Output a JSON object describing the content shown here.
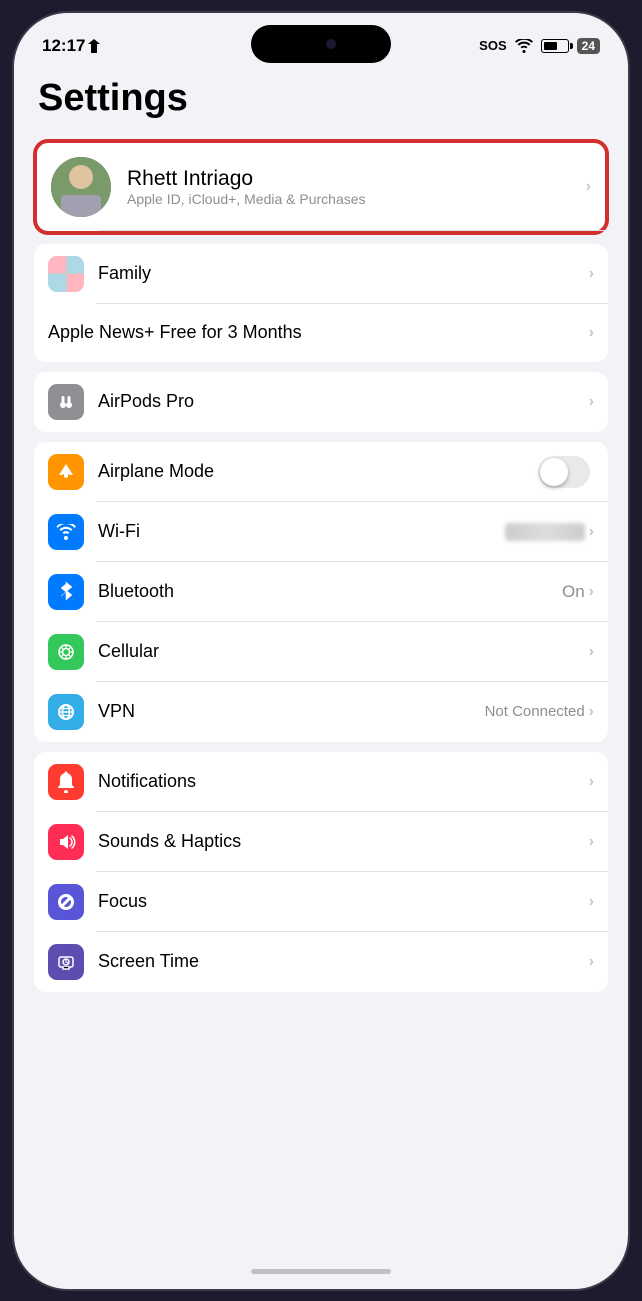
{
  "status_bar": {
    "time": "12:17",
    "sos": "SOS",
    "location_icon": "location-arrow"
  },
  "page": {
    "title": "Settings"
  },
  "profile": {
    "name": "Rhett Intriago",
    "subtitle": "Apple ID, iCloud+, Media & Purchases",
    "chevron": "›"
  },
  "group1": {
    "items": [
      {
        "label": "Family",
        "chevron": "›"
      },
      {
        "label": "Apple News+ Free for 3 Months",
        "chevron": "›"
      }
    ]
  },
  "group2": {
    "items": [
      {
        "label": "AirPods Pro",
        "chevron": "›"
      }
    ]
  },
  "group3": {
    "items": [
      {
        "label": "Airplane Mode",
        "value": ""
      },
      {
        "label": "Wi-Fi",
        "value": "",
        "chevron": "›"
      },
      {
        "label": "Bluetooth",
        "value": "On",
        "chevron": "›"
      },
      {
        "label": "Cellular",
        "chevron": "›"
      },
      {
        "label": "VPN",
        "value": "Not Connected",
        "chevron": "›"
      }
    ]
  },
  "group4": {
    "items": [
      {
        "label": "Notifications",
        "chevron": "›"
      },
      {
        "label": "Sounds & Haptics",
        "chevron": "›"
      },
      {
        "label": "Focus",
        "chevron": "›"
      },
      {
        "label": "Screen Time",
        "chevron": "›"
      }
    ]
  }
}
